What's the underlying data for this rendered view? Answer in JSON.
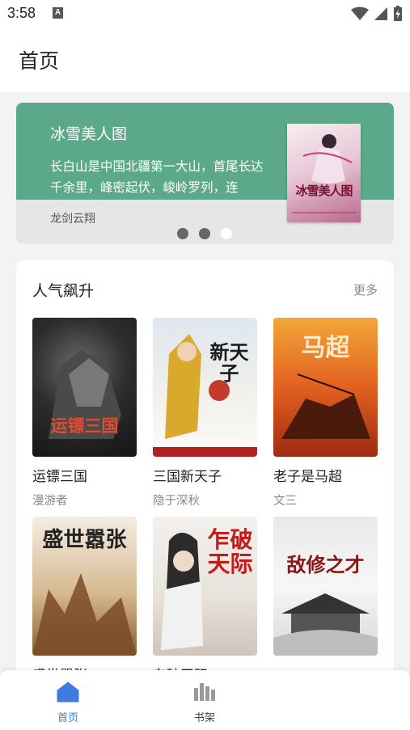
{
  "status_bar": {
    "time": "3:58",
    "notification_letter": "A"
  },
  "app_bar": {
    "title": "首页"
  },
  "banner": {
    "title": "冰雪美人图",
    "description": "长白山是中国北疆第一大山，首尾长达千余里，峰密起伏，峻岭罗列，连",
    "author": "龙剑云翔",
    "cover_text": "冰雪美人图",
    "pages": 3,
    "active_page": 3,
    "accent_color": "#5ba88a"
  },
  "section": {
    "title": "人气飙升",
    "more_label": "更多",
    "books": [
      {
        "title": "运镖三国",
        "author": "漫游者",
        "cover_text": "运镖三国"
      },
      {
        "title": "三国新天子",
        "author": "隐于深秋",
        "cover_text": "新天子"
      },
      {
        "title": "老子是马超",
        "author": "文三",
        "cover_text": "马超"
      },
      {
        "title": "盛世嚣张",
        "author": "",
        "cover_text": "盛世嚣张"
      },
      {
        "title": "东破天际",
        "author": "",
        "cover_text": "乍破天际"
      },
      {
        "title": "",
        "author": "",
        "cover_text": "敌修之才"
      }
    ]
  },
  "bottom_nav": {
    "items": [
      {
        "label": "首页",
        "icon": "home-icon",
        "active": true
      },
      {
        "label": "书架",
        "icon": "bookshelf-icon",
        "active": false
      }
    ],
    "active_color": "#3d7be0"
  }
}
